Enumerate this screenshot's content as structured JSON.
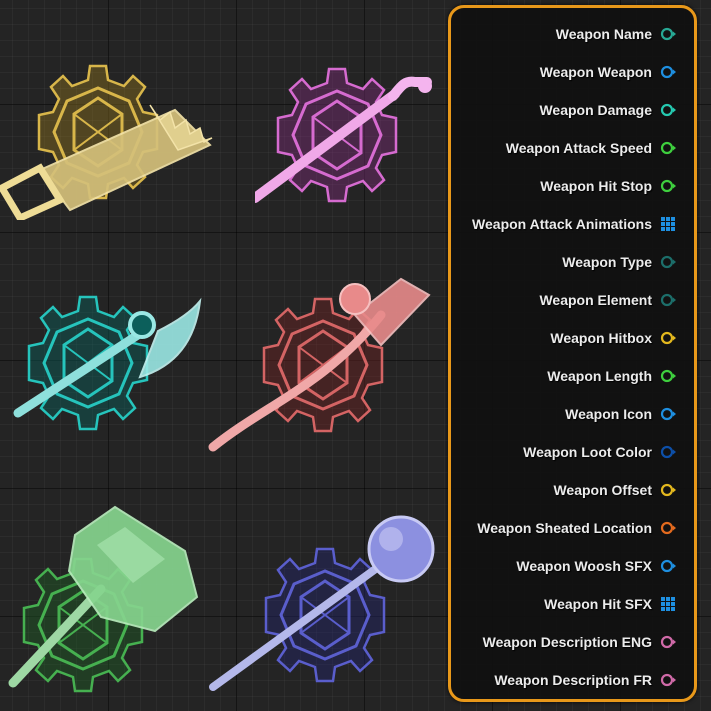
{
  "weapons": [
    {
      "name": "saw-weapon-icon",
      "color": "#c9a53a"
    },
    {
      "name": "pipe-weapon-icon",
      "color": "#c15fb8"
    },
    {
      "name": "axe-weapon-icon",
      "color": "#1fa6a0"
    },
    {
      "name": "broom-weapon-icon",
      "color": "#b54848"
    },
    {
      "name": "mace-weapon-icon",
      "color": "#3a9a46"
    },
    {
      "name": "scepter-weapon-icon",
      "color": "#4b4fb0"
    }
  ],
  "pins": [
    {
      "label": "Weapon Name",
      "type": "pin",
      "color": "#27a894"
    },
    {
      "label": "Weapon Weapon",
      "type": "pin",
      "color": "#1e8fe0"
    },
    {
      "label": "Weapon Damage",
      "type": "pin",
      "color": "#25c9b0"
    },
    {
      "label": "Weapon Attack Speed",
      "type": "pin",
      "color": "#3ecf3e"
    },
    {
      "label": "Weapon Hit Stop",
      "type": "pin",
      "color": "#3ecf3e"
    },
    {
      "label": "Weapon Attack Animations",
      "type": "grid",
      "color": "#1e8fe0"
    },
    {
      "label": "Weapon Type",
      "type": "pin",
      "color": "#1c6e6a"
    },
    {
      "label": "Weapon Element",
      "type": "pin",
      "color": "#1c6e6a"
    },
    {
      "label": "Weapon Hitbox",
      "type": "pin",
      "color": "#e3b81e"
    },
    {
      "label": "Weapon Length",
      "type": "pin",
      "color": "#3ecf3e"
    },
    {
      "label": "Weapon Icon",
      "type": "pin",
      "color": "#1e8fe0"
    },
    {
      "label": "Weapon Loot Color",
      "type": "pin",
      "color": "#0d4fa8"
    },
    {
      "label": "Weapon Offset",
      "type": "pin",
      "color": "#e3b81e"
    },
    {
      "label": "Weapon Sheated Location",
      "type": "pin",
      "color": "#e36a1e"
    },
    {
      "label": "Weapon Woosh SFX",
      "type": "pin",
      "color": "#1e8fe0"
    },
    {
      "label": "Weapon Hit SFX",
      "type": "grid",
      "color": "#1e8fe0"
    },
    {
      "label": "Weapon Description ENG",
      "type": "pin",
      "color": "#d06aa8"
    },
    {
      "label": "Weapon Description FR",
      "type": "pin",
      "color": "#d06aa8"
    }
  ]
}
